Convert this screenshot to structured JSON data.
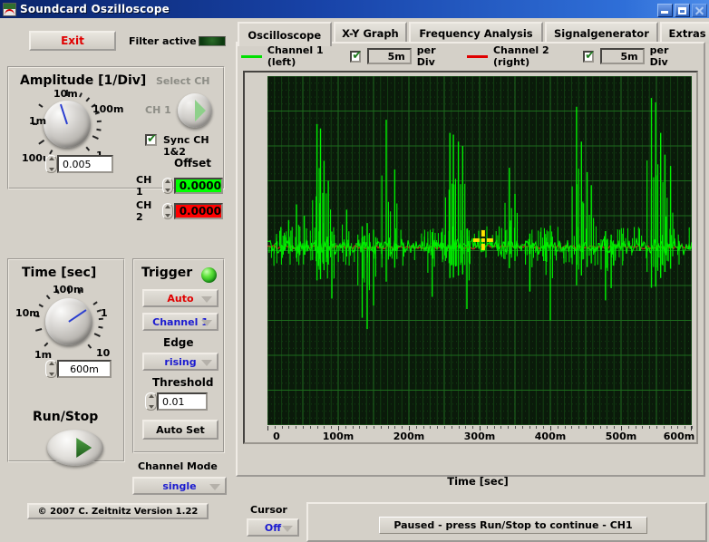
{
  "window": {
    "title": "Soundcard Oszilloscope",
    "icon": "oscilloscope-icon",
    "buttons": {
      "minimize": "minimize-icon",
      "maximize": "maximize-icon",
      "close": "close-icon"
    }
  },
  "toolbar": {
    "exit_label": "Exit",
    "filter_label": "Filter active",
    "filter_state": "off",
    "filter_color": "#1c5a1c"
  },
  "amplitude": {
    "title": "Amplitude [1/Div]",
    "dial_labels": [
      "1m",
      "10m",
      "100m",
      "1",
      "100u"
    ],
    "value": "0.005",
    "select_ch_title": "Select CH",
    "ch_label": "CH 1",
    "sync_label": "Sync CH 1&2",
    "sync_checked": true,
    "offset_title": "Offset",
    "offsets": [
      {
        "tag": "CH 1",
        "value": "0.0000",
        "color": "#00ff00"
      },
      {
        "tag": "CH 2",
        "value": "0.0000",
        "color": "#ff0000"
      }
    ]
  },
  "time": {
    "title": "Time [sec]",
    "dial_labels": [
      "10m",
      "100m",
      "1",
      "10",
      "1m"
    ],
    "value": "600m",
    "runstop_title": "Run/Stop",
    "runstop_icon": "play-icon"
  },
  "trigger": {
    "title": "Trigger",
    "led": "green",
    "mode": "Auto",
    "source": "Channel 1",
    "edge_label": "Edge",
    "edge": "rising",
    "threshold_label": "Threshold",
    "threshold": "0.01",
    "autoset_label": "Auto Set"
  },
  "channel_mode": {
    "label": "Channel Mode",
    "value": "single"
  },
  "copyright": "© 2007   C. Zeitnitz Version 1.22",
  "tabs": [
    {
      "label": "Oscilloscope",
      "active": true
    },
    {
      "label": "X-Y Graph",
      "active": false
    },
    {
      "label": "Frequency Analysis",
      "active": false
    },
    {
      "label": "Signalgenerator",
      "active": false
    },
    {
      "label": "Extras",
      "active": false
    }
  ],
  "channels": [
    {
      "name": "Channel 1 (left)",
      "color": "#00e000",
      "enabled": true,
      "per_div": "5m",
      "per_div_label": "per Div"
    },
    {
      "name": "Channel 2 (right)",
      "color": "#e00000",
      "enabled": true,
      "per_div": "5m",
      "per_div_label": "per Div"
    }
  ],
  "cursor": {
    "label": "Cursor",
    "value": "Off"
  },
  "status": {
    "text": "Paused - press Run/Stop to continue - CH1"
  },
  "chart_data": {
    "type": "line",
    "title": "",
    "xlabel": "Time [sec]",
    "ylabel": "",
    "xlim": [
      0,
      0.6
    ],
    "ylim": [
      -0.02,
      0.02
    ],
    "grid": true,
    "background": "#0a1a0a",
    "grid_color": "#1d6b1d",
    "xticks": [
      0,
      0.1,
      0.2,
      0.3,
      0.4,
      0.5,
      0.6
    ],
    "xticklabels": [
      "0",
      "100m",
      "200m",
      "300m",
      "400m",
      "500m",
      "600m"
    ],
    "divisions_x": 12,
    "divisions_y": 10,
    "cursor_marker": {
      "x": 0.305,
      "y": 0.0012,
      "color": "#ffe000",
      "shape": "cross"
    },
    "series": [
      {
        "name": "Channel 1 (left)",
        "color": "#00ee00",
        "per_div": "5m",
        "description": "Noisy audio waveform with clustered transient spikes",
        "spikes": [
          {
            "x": 0.019,
            "amp": 0.0022
          },
          {
            "x": 0.03,
            "amp": 0.003
          },
          {
            "x": 0.041,
            "amp": 0.0048
          },
          {
            "x": 0.052,
            "amp": 0.0035
          },
          {
            "x": 0.07,
            "amp": 0.014
          },
          {
            "x": 0.075,
            "amp": 0.0135
          },
          {
            "x": 0.08,
            "amp": 0.0098
          },
          {
            "x": 0.086,
            "amp": 0.0075
          },
          {
            "x": 0.091,
            "amp": -0.006
          },
          {
            "x": 0.112,
            "amp": 0.0042
          },
          {
            "x": 0.134,
            "amp": -0.0082
          },
          {
            "x": 0.141,
            "amp": -0.0095
          },
          {
            "x": 0.15,
            "amp": -0.0068
          },
          {
            "x": 0.168,
            "amp": 0.0145
          },
          {
            "x": 0.18,
            "amp": 0.0088
          },
          {
            "x": 0.233,
            "amp": -0.0058
          },
          {
            "x": 0.258,
            "amp": 0.013
          },
          {
            "x": 0.263,
            "amp": 0.0128
          },
          {
            "x": 0.27,
            "amp": 0.012
          },
          {
            "x": 0.276,
            "amp": 0.0115
          },
          {
            "x": 0.282,
            "amp": -0.0072
          },
          {
            "x": 0.342,
            "amp": 0.009
          },
          {
            "x": 0.35,
            "amp": 0.006
          },
          {
            "x": 0.371,
            "amp": -0.0052
          },
          {
            "x": 0.4,
            "amp": -0.0085
          },
          {
            "x": 0.437,
            "amp": 0.016
          },
          {
            "x": 0.444,
            "amp": 0.012
          },
          {
            "x": 0.452,
            "amp": 0.0085
          },
          {
            "x": 0.458,
            "amp": 0.007
          },
          {
            "x": 0.478,
            "amp": -0.0062
          },
          {
            "x": 0.486,
            "amp": -0.0048
          },
          {
            "x": 0.543,
            "amp": 0.017
          },
          {
            "x": 0.549,
            "amp": 0.0165
          },
          {
            "x": 0.556,
            "amp": 0.013
          },
          {
            "x": 0.562,
            "amp": 0.0105
          },
          {
            "x": 0.57,
            "amp": 0.0092
          }
        ],
        "baseline": 0.0005,
        "noise_amp": 0.0012
      },
      {
        "name": "Channel 2 (right)",
        "color": "#cc2222",
        "per_div": "5m",
        "description": "Flat near-zero trace overlaid under Channel 1",
        "baseline": 0.0004,
        "noise_amp": 0.0002
      }
    ]
  }
}
